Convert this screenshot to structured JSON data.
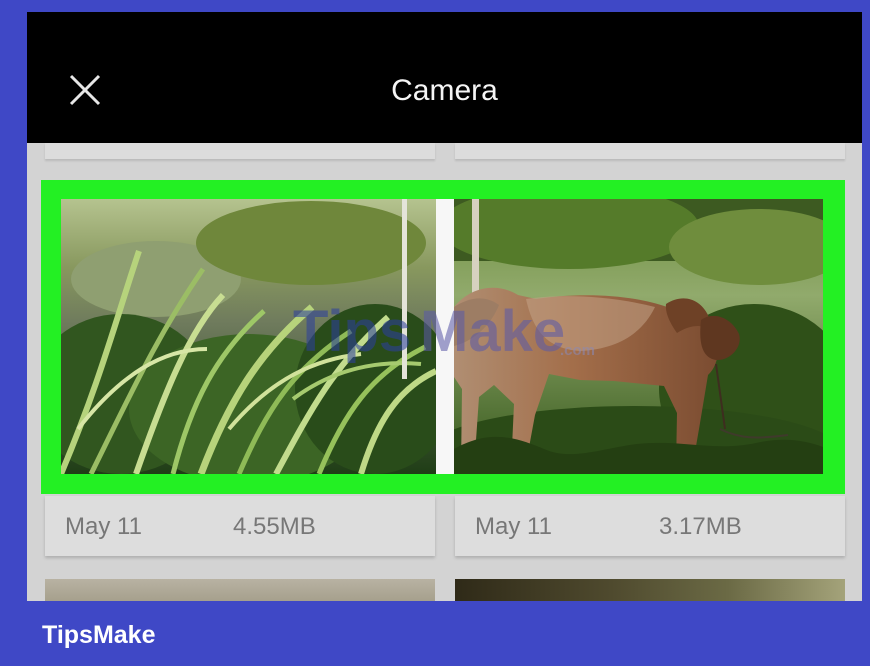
{
  "header": {
    "title": "Camera",
    "close_icon": "close-icon"
  },
  "colors": {
    "frame": "#3f48c6",
    "titlebar": "#000000",
    "gallery_background": "#d3d3d3",
    "selection_highlight": "#23f023",
    "card_text": "#777777",
    "brand_text": "#ffffff"
  },
  "photos": [
    {
      "date": "May 11",
      "size": "4.55MB",
      "subject": "plants",
      "selected": true
    },
    {
      "date": "May 11",
      "size": "3.17MB",
      "subject": "cow",
      "selected": true
    }
  ],
  "watermark": {
    "text": "TipsMake",
    "suffix": ".com"
  },
  "brand": {
    "label": "TipsMake"
  }
}
